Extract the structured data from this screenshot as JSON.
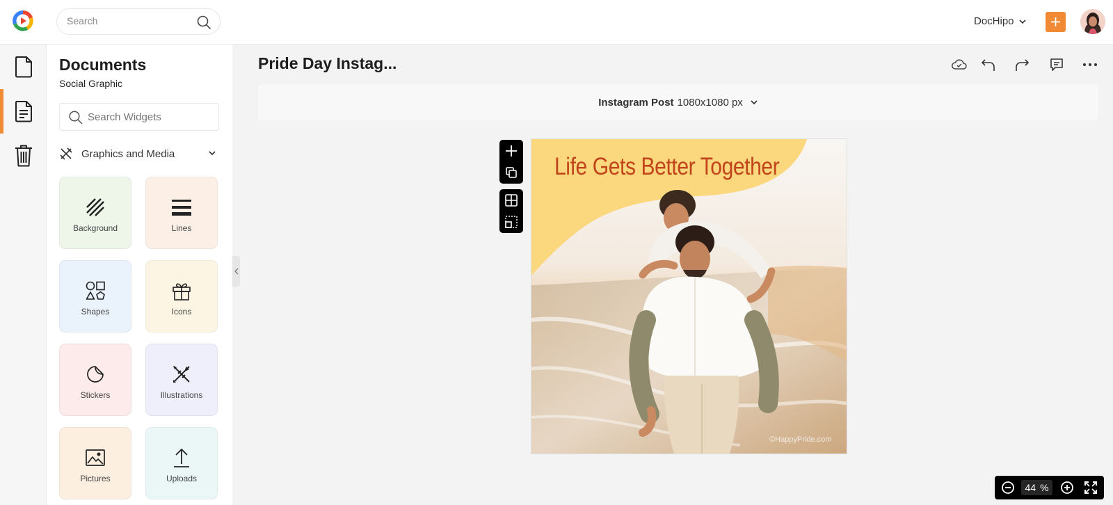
{
  "topbar": {
    "search_placeholder": "Search",
    "account_label": "DocHipo",
    "plus_icon": "plus-icon",
    "colors": {
      "accent": "#f08a35"
    }
  },
  "rail": {
    "items": [
      {
        "icon": "document-icon",
        "active": false
      },
      {
        "icon": "document-lines-icon",
        "active": true
      },
      {
        "icon": "trash-icon",
        "active": false
      }
    ]
  },
  "panel": {
    "title": "Documents",
    "subtitle": "Social Graphic",
    "search_placeholder": "Search Widgets",
    "category_label": "Graphics and Media",
    "tiles": [
      {
        "label": "Background",
        "icon": "diagonal-lines-icon",
        "bg": "#eef6ea"
      },
      {
        "label": "Lines",
        "icon": "lines-icon",
        "bg": "#fbefe6"
      },
      {
        "label": "Shapes",
        "icon": "shapes-icon",
        "bg": "#eaf2fb"
      },
      {
        "label": "Icons",
        "icon": "gift-icon",
        "bg": "#fdf5e3"
      },
      {
        "label": "Stickers",
        "icon": "sticker-icon",
        "bg": "#fcebea"
      },
      {
        "label": "Illustrations",
        "icon": "pen-brush-icon",
        "bg": "#efeffb"
      },
      {
        "label": "Pictures",
        "icon": "picture-icon",
        "bg": "#fcefe0"
      },
      {
        "label": "Uploads",
        "icon": "upload-icon",
        "bg": "#eaf7f6"
      }
    ]
  },
  "workspace": {
    "doc_title": "Pride Day Instag...",
    "size_bold": "Instagram Post",
    "size_dims": "1080x1080 px",
    "canvas_headline": "Life Gets Better Together",
    "canvas_watermark": "©HappyPride.com",
    "colors": {
      "headline": "#c1441b",
      "blob": "#fbd77e"
    },
    "zoom_value": "44",
    "zoom_unit": "%"
  }
}
